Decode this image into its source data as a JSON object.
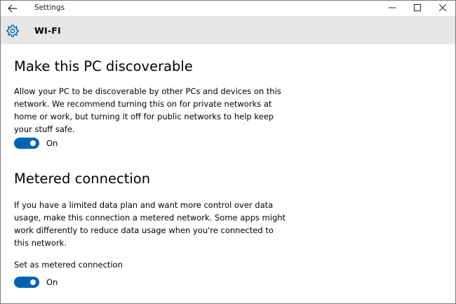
{
  "window": {
    "title": "Settings"
  },
  "header": {
    "title": "WI-FI"
  },
  "discoverable": {
    "title": "Make this PC discoverable",
    "description_lines": [
      "Allow your PC to be discoverable by other PCs and devices on this",
      "network. We recommend turning this on for private networks at",
      "home or work, but turning it off for public networks to help keep",
      "your stuff safe."
    ],
    "toggle_state": "On",
    "toggle_on": true
  },
  "metered": {
    "title": "Metered connection",
    "description_lines": [
      "If you have a limited data plan and want more control over data",
      "usage, make this connection a metered network. Some apps might",
      "work differently to reduce data usage when you're connected to",
      "this network."
    ],
    "setting_label": "Set as metered connection",
    "toggle_state": "On",
    "toggle_on": true
  },
  "colors": {
    "accent": "#0063b1",
    "header_bg": "#e6e6e6"
  },
  "icons": {
    "back": "back-arrow-icon",
    "settings": "gear-icon",
    "minimize": "minimize-icon",
    "maximize": "maximize-icon",
    "close": "close-icon"
  }
}
